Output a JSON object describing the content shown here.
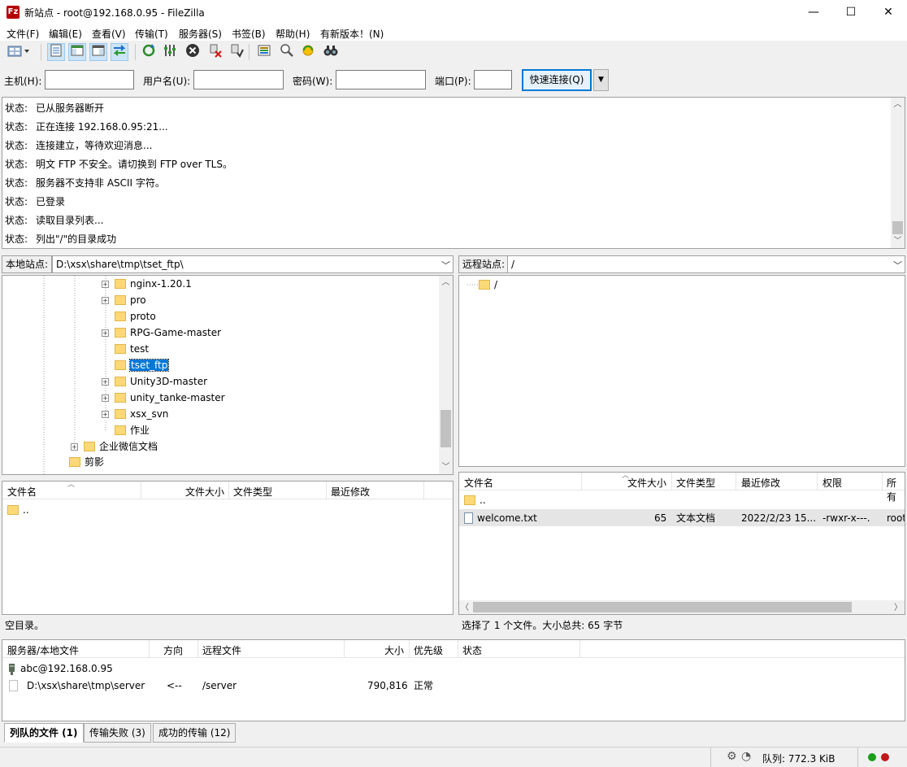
{
  "window": {
    "title": "新站点 - root@192.168.0.95 - FileZilla",
    "icon_text": "Fz",
    "minimize": "—",
    "maximize": "☐",
    "close": "✕"
  },
  "menu": [
    "文件(F)",
    "编辑(E)",
    "查看(V)",
    "传输(T)",
    "服务器(S)",
    "书签(B)",
    "帮助(H)",
    "有新版本！(N)"
  ],
  "quickconnect": {
    "host_label": "主机(H):",
    "host_value": "",
    "user_label": "用户名(U):",
    "user_value": "",
    "pass_label": "密码(W):",
    "pass_value": "",
    "port_label": "端口(P):",
    "port_value": "",
    "button": "快速连接(Q)"
  },
  "log": [
    {
      "k": "状态:",
      "v": "已从服务器断开"
    },
    {
      "k": "状态:",
      "v": "正在连接 192.168.0.95:21..."
    },
    {
      "k": "状态:",
      "v": "连接建立，等待欢迎消息..."
    },
    {
      "k": "状态:",
      "v": "明文 FTP 不安全。请切换到 FTP over TLS。"
    },
    {
      "k": "状态:",
      "v": "服务器不支持非 ASCII 字符。"
    },
    {
      "k": "状态:",
      "v": "已登录"
    },
    {
      "k": "状态:",
      "v": "读取目录列表..."
    },
    {
      "k": "状态:",
      "v": "列出\"/\"的目录成功"
    }
  ],
  "local": {
    "site_label": "本地站点:",
    "path": "D:\\xsx\\share\\tmp\\tset_ftp\\",
    "tree": [
      {
        "name": "nginx-1.20.1",
        "expand": "+"
      },
      {
        "name": "pro",
        "expand": "+"
      },
      {
        "name": "proto",
        "expand": ""
      },
      {
        "name": "RPG-Game-master",
        "expand": "+"
      },
      {
        "name": "test",
        "expand": ""
      },
      {
        "name": "tset_ftp",
        "expand": "",
        "selected": true
      },
      {
        "name": "Unity3D-master",
        "expand": "+"
      },
      {
        "name": "unity_tanke-master",
        "expand": "+"
      },
      {
        "name": "xsx_svn",
        "expand": "+"
      },
      {
        "name": "作业",
        "expand": ""
      },
      {
        "name": "企业微信文档",
        "expand": "+"
      },
      {
        "name": "剪影",
        "expand": ""
      }
    ],
    "columns": [
      "文件名",
      "文件大小",
      "文件类型",
      "最近修改"
    ],
    "files": [
      {
        "name": ".."
      }
    ],
    "status": "空目录。"
  },
  "remote": {
    "site_label": "远程站点:",
    "path": "/",
    "tree": [
      {
        "name": "/"
      }
    ],
    "columns": [
      "文件名",
      "文件大小",
      "文件类型",
      "最近修改",
      "权限",
      "所有"
    ],
    "files": [
      {
        "name": "..",
        "size": "",
        "type": "",
        "modified": "",
        "perm": "",
        "owner": ""
      },
      {
        "name": "welcome.txt",
        "size": "65",
        "type": "文本文档",
        "modified": "2022/2/23 15...",
        "perm": "-rwxr-x---.",
        "owner": "root"
      }
    ],
    "status": "选择了 1 个文件。大小总共: 65 字节"
  },
  "queue": {
    "columns": [
      "服务器/本地文件",
      "方向",
      "远程文件",
      "大小",
      "优先级",
      "状态"
    ],
    "server": "abc@192.168.0.95",
    "item": {
      "local": "D:\\xsx\\share\\tmp\\server",
      "dir": "<--",
      "remote": "/server",
      "size": "790,816",
      "priority": "正常"
    }
  },
  "tabs": [
    "列队的文件 (1)",
    "传输失败 (3)",
    "成功的传输 (12)"
  ],
  "statusbar": {
    "queue": "队列: 772.3 KiB"
  },
  "colors": {
    "accent": "#0078d7",
    "folder": "#fcd977",
    "led_green": "#1a9e1a",
    "led_red": "#c01818"
  }
}
